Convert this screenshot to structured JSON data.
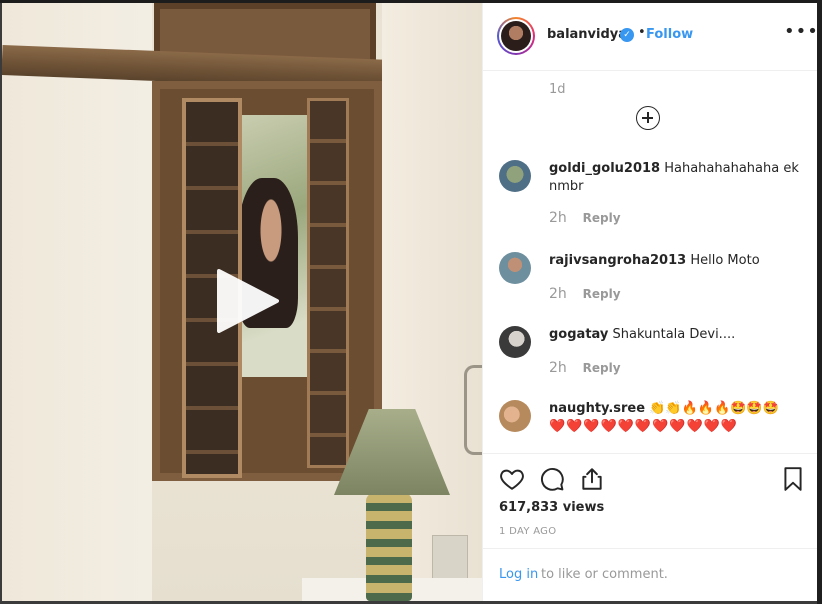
{
  "post": {
    "username": "balanvidya",
    "verified_icon": "verified-badge-icon",
    "separator": "•",
    "follow_label": "Follow",
    "more_icon": "more-options-icon",
    "more_glyph": "•••"
  },
  "comments": {
    "caption_time": "1d",
    "load_more_icon": "plus-circle-icon",
    "items": [
      {
        "user": "goldi_golu2018",
        "text": "Hahahahahahaha ek nmbr",
        "time": "2h",
        "reply": "Reply"
      },
      {
        "user": "rajivsangroha2013",
        "text": "Hello Moto",
        "time": "2h",
        "reply": "Reply"
      },
      {
        "user": "gogatay",
        "text": "Shakuntala Devi....",
        "time": "2h",
        "reply": "Reply"
      },
      {
        "user": "naughty.sree",
        "text": "👏👏🔥🔥🔥🤩🤩🤩",
        "text2": "❤️❤️❤️❤️❤️❤️❤️❤️❤️❤️❤️"
      }
    ]
  },
  "actions": {
    "like_icon": "heart-icon",
    "comment_icon": "comment-icon",
    "share_icon": "share-icon",
    "save_icon": "bookmark-icon",
    "views": "617,833 views",
    "date": "1 DAY AGO"
  },
  "login": {
    "link": "Log in",
    "rest": "to like or comment."
  },
  "media": {
    "play_icon": "play-icon"
  },
  "colors": {
    "accent": "#3897f0",
    "text": "#262626",
    "muted": "#999999",
    "heart": "#e0213a"
  }
}
